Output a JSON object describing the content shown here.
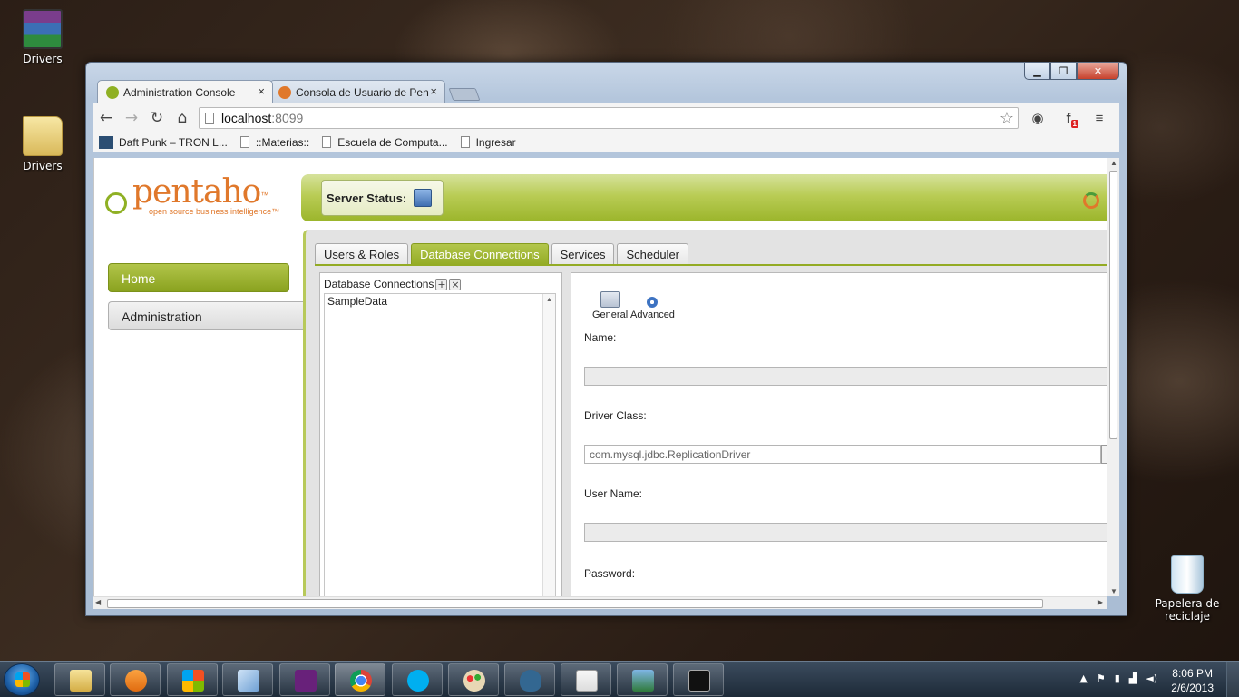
{
  "desktop": {
    "icons": [
      {
        "label": "Drivers",
        "kind": "winrar-archive-icon"
      },
      {
        "label": "Drivers",
        "kind": "folder-icon"
      },
      {
        "label": "Papelera de reciclaje",
        "kind": "recycle-bin-icon"
      }
    ]
  },
  "browser": {
    "tabs": [
      {
        "label": "Administration Console",
        "active": true
      },
      {
        "label": "Consola de Usuario de Pen",
        "active": false
      }
    ],
    "close_glyph": "×",
    "url_host": "localhost",
    "url_port": ":8099",
    "bookmarks": [
      {
        "label": "Daft Punk – TRON L..."
      },
      {
        "label": "::Materias::"
      },
      {
        "label": "Escuela de Computa..."
      },
      {
        "label": "Ingresar"
      }
    ],
    "extension_badge": "1"
  },
  "app": {
    "logo_text": "pentaho",
    "logo_tm": "™",
    "logo_tagline": "open source business intelligence™",
    "server_status_label": "Server Status:",
    "nav": {
      "home": "Home",
      "administration": "Administration"
    },
    "tabs": [
      {
        "label": "Users & Roles",
        "active": false
      },
      {
        "label": "Database Connections",
        "active": true
      },
      {
        "label": "Services",
        "active": false
      },
      {
        "label": "Scheduler",
        "active": false
      }
    ],
    "connections_header": "Database Connections",
    "add_glyph": "+",
    "remove_glyph": "×",
    "connections": [
      "SampleData"
    ],
    "modes": {
      "general": "General",
      "advanced": "Advanced"
    },
    "form": {
      "name_label": "Name:",
      "name_value": "",
      "driver_label": "Driver Class:",
      "driver_value": "com.mysql.jdbc.ReplicationDriver",
      "user_label": "User Name:",
      "user_value": "",
      "password_label": "Password:"
    }
  },
  "taskbar": {
    "time": "8:06 PM",
    "date": "2/6/2013",
    "apps": [
      "file-explorer",
      "media-player",
      "windows-store",
      "virtualbox",
      "visual-studio",
      "chrome",
      "skype",
      "paint",
      "postgresql",
      "java",
      "photo-viewer",
      "command-prompt"
    ]
  },
  "colors": {
    "pentaho_green": "#93ab24",
    "pentaho_orange": "#e0782b"
  }
}
